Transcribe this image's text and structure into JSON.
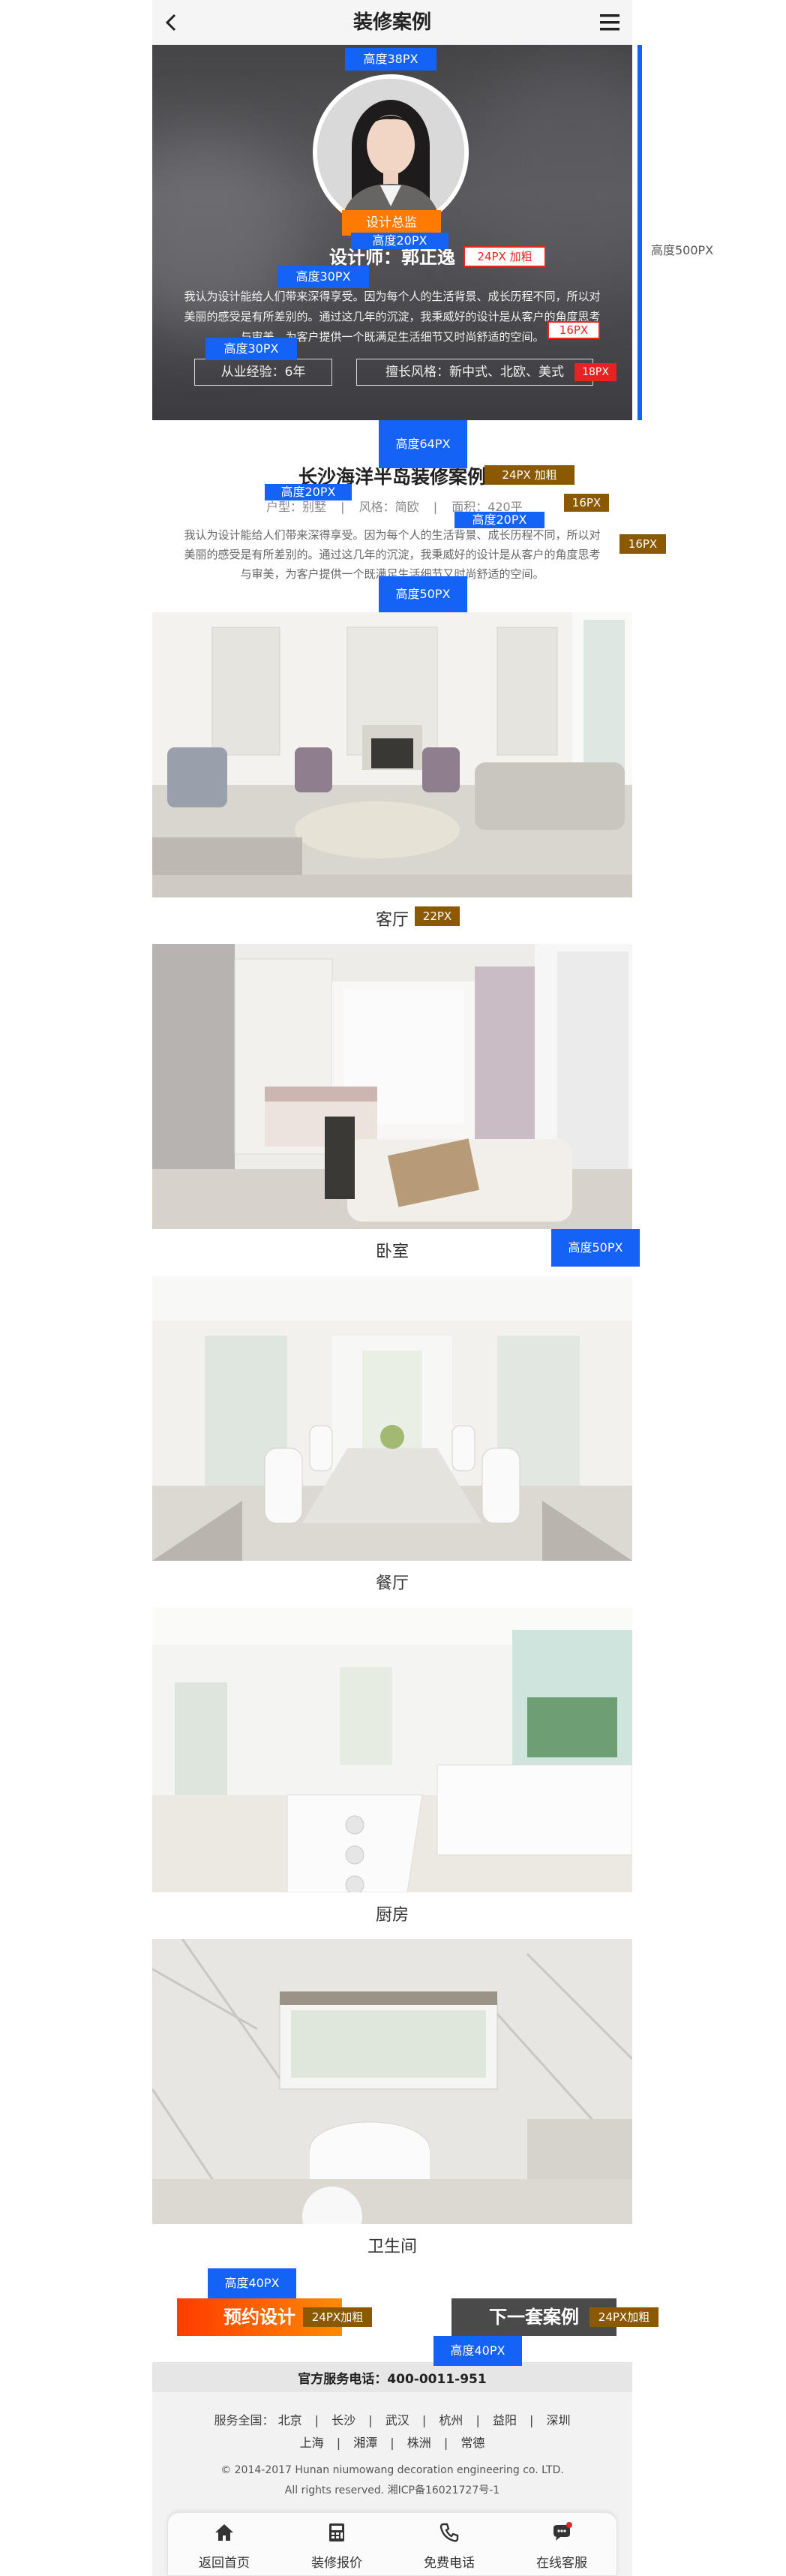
{
  "header": {
    "title": "装修案例",
    "back_icon": "chevron-left-icon",
    "menu_icon": "hamburger-menu-icon"
  },
  "designer": {
    "badge": "设计总监",
    "name": "设计师：郭正逸",
    "bio": [
      "我认为设计能给人们带来深得享受。因为每个人的生活背景、成长历程不同，所以对",
      "美丽的感受是有所差别的。通过这几年的沉淀，我秉威好的设计是从客户的角度思考",
      "与审美，为客户提供一个既满足生活细节又时尚舒适的空间。"
    ],
    "experience": "从业经验：6年",
    "style": "擅长风格：新中式、北欧、美式"
  },
  "project": {
    "title": "长沙海洋半岛装修案例",
    "meta_type": "户型：别墅",
    "meta_style": "风格：简欧",
    "meta_area": "面积：420平",
    "desc": [
      "我认为设计能给人们带来深得享受。因为每个人的生活背景、成长历程不同，所以对",
      "美丽的感受是有所差别的。通过这几年的沉淀，我秉威好的设计是从客户的角度思考",
      "与审美，为客户提供一个既满足生活细节又时尚舒适的空间。"
    ]
  },
  "rooms": [
    {
      "label": "客厅"
    },
    {
      "label": "卧室"
    },
    {
      "label": "餐厅"
    },
    {
      "label": "厨房"
    },
    {
      "label": "卫生间"
    }
  ],
  "actions": {
    "book": "预约设计",
    "next": "下一套案例"
  },
  "footer": {
    "phone": "官方服务电话：400-0011-951",
    "cities_label": "服务全国：",
    "cities_row1": [
      "北京",
      "长沙",
      "武汉",
      "杭州",
      "益阳",
      "深圳"
    ],
    "cities_row2": [
      "上海",
      "湘潭",
      "株洲",
      "常德"
    ],
    "sep": "|",
    "copyright": "© 2014-2017 Hunan niumowang decoration engineering co. LTD.",
    "rights": "All rights reserved.  湘ICP备16021727号-1"
  },
  "nav": [
    {
      "label": "返回首页",
      "icon": "home-icon"
    },
    {
      "label": "装修报价",
      "icon": "calculator-icon"
    },
    {
      "label": "免费电话",
      "icon": "phone-icon"
    },
    {
      "label": "在线客服",
      "icon": "chat-icon"
    }
  ],
  "annotations": {
    "h38": "高度38PX",
    "h20a": "高度20PX",
    "f24a": "24PX 加粗",
    "h30a": "高度30PX",
    "f16a": "16PX",
    "h30b": "高度30PX",
    "f18": "18PX",
    "h500": "高度500PX",
    "h64": "高度64PX",
    "f24b": "24PX 加粗",
    "h20b": "高度20PX",
    "f16b": "16PX",
    "h20c": "高度20PX",
    "f16c": "16PX",
    "h50a": "高度50PX",
    "f22": "22PX",
    "h50b": "高度50PX",
    "h40a": "高度40PX",
    "f24c": "24PX加粗",
    "f24d": "24PX加粗",
    "h40b": "高度40PX"
  },
  "colors": {
    "annot_blue": "#1463f6",
    "annot_brown": "#8b5a00",
    "accent_orange": "#ff6a00",
    "dark_button": "#4a4a4a"
  }
}
